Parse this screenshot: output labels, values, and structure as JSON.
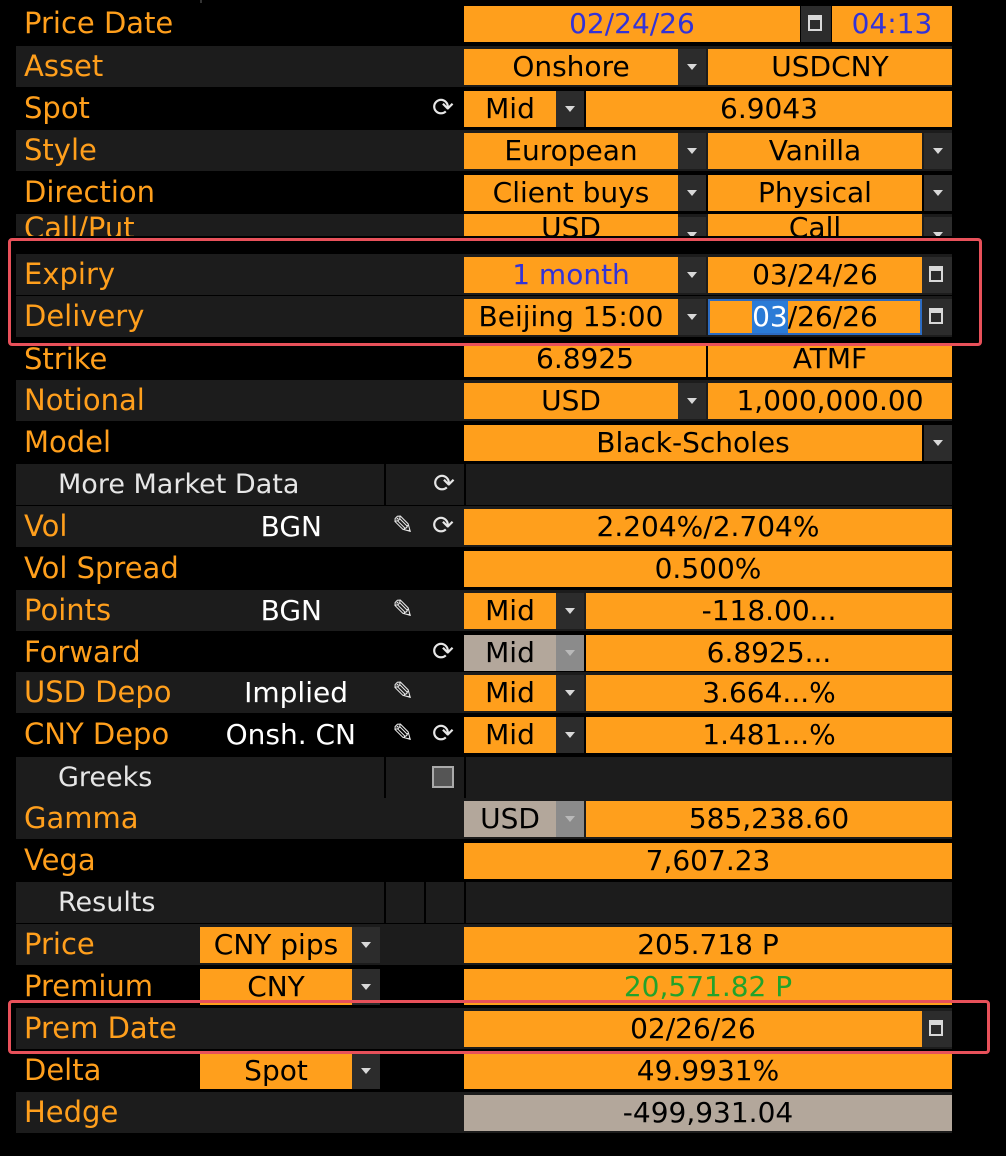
{
  "price_date": {
    "label": "Price Date",
    "date": "02/24/26",
    "time": "04:13"
  },
  "asset": {
    "label": "Asset",
    "market": "Onshore",
    "pair": "USDCNY"
  },
  "spot": {
    "label": "Spot",
    "side": "Mid",
    "value": "6.9043"
  },
  "style": {
    "label": "Style",
    "exercise": "European",
    "type": "Vanilla"
  },
  "direction": {
    "label": "Direction",
    "side": "Client buys",
    "settle": "Physical"
  },
  "callput": {
    "label": "Call/Put",
    "ccy": "USD",
    "type": "Call"
  },
  "expiry": {
    "label": "Expiry",
    "tenor": "1 month",
    "date": "03/24/26"
  },
  "delivery": {
    "label": "Delivery",
    "cut": "Beijing 15:00",
    "date_sel": "03",
    "date_rest": "/26/26"
  },
  "strike": {
    "label": "Strike",
    "value": "6.8925",
    "mode": "ATMF"
  },
  "notional": {
    "label": "Notional",
    "ccy": "USD",
    "amount": "1,000,000.00"
  },
  "model": {
    "label": "Model",
    "value": "Black-Scholes"
  },
  "market_section": {
    "title": "More Market Data"
  },
  "vol": {
    "label": "Vol",
    "source": "BGN",
    "value": "2.204%/2.704%"
  },
  "vol_spread": {
    "label": "Vol Spread",
    "value": "0.500%"
  },
  "points": {
    "label": "Points",
    "source": "BGN",
    "side": "Mid",
    "value": "-118.00..."
  },
  "forward": {
    "label": "Forward",
    "side": "Mid",
    "value": "6.8925..."
  },
  "usd_depo": {
    "label": "USD Depo",
    "source": "Implied",
    "side": "Mid",
    "value": "3.664...%"
  },
  "cny_depo": {
    "label": "CNY Depo",
    "source": "Onsh. CN",
    "side": "Mid",
    "value": "1.481...%"
  },
  "greeks_section": {
    "title": "Greeks"
  },
  "gamma": {
    "label": "Gamma",
    "ccy": "USD",
    "value": "585,238.60"
  },
  "vega": {
    "label": "Vega",
    "value": "7,607.23"
  },
  "results_section": {
    "title": "Results"
  },
  "price": {
    "label": "Price",
    "unit": "CNY pips",
    "value": "205.718 P"
  },
  "premium": {
    "label": "Premium",
    "ccy": "CNY",
    "value": "20,571.82 P"
  },
  "prem_date": {
    "label": "Prem Date",
    "value": "02/26/26"
  },
  "delta": {
    "label": "Delta",
    "mode": "Spot",
    "value": "49.9931%"
  },
  "hedge": {
    "label": "Hedge",
    "value": "-499,931.04"
  },
  "colors": {
    "field": "#ff9f1c",
    "label": "#ff9f1c",
    "gray_field": "#b3a79b",
    "highlight": "#e8515a",
    "tenor_text": "#3233d8",
    "premium_text": "#22a32b"
  },
  "icons": [
    "refresh-icon",
    "pencil-icon",
    "calendar-icon",
    "dropdown-arrow-icon",
    "checkbox-icon"
  ]
}
